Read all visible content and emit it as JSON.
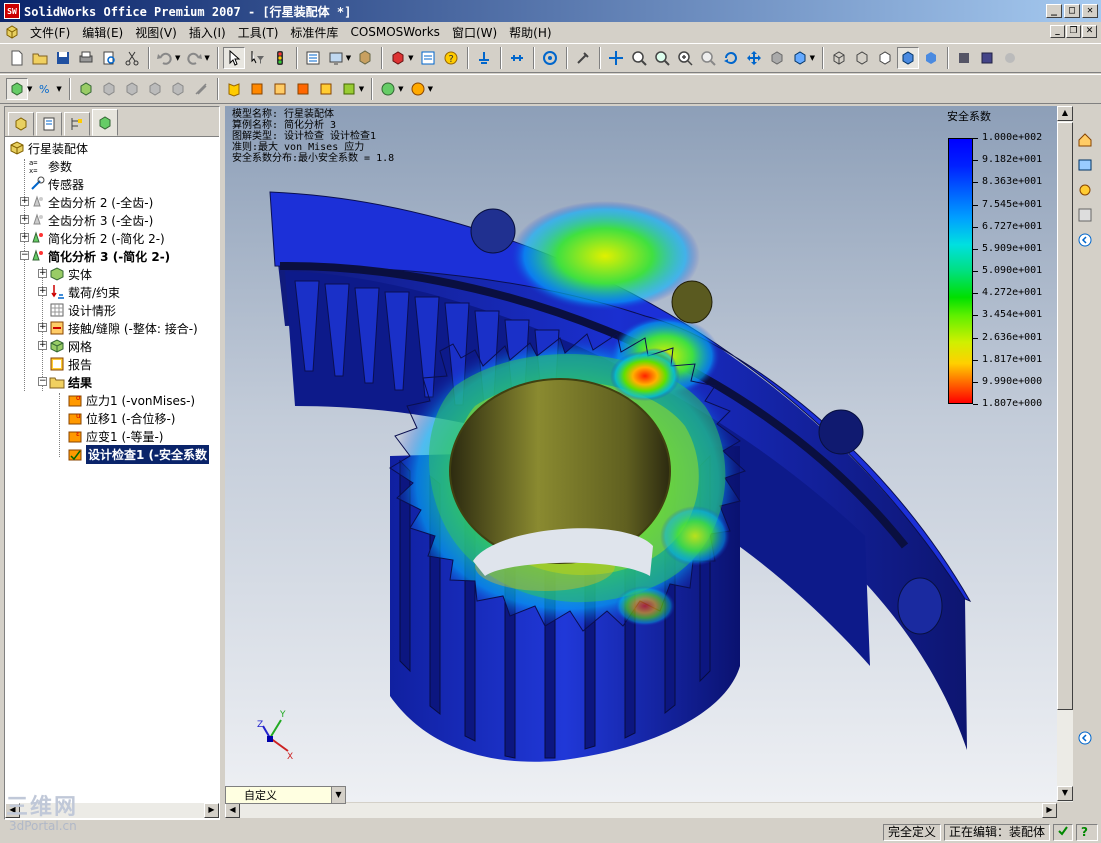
{
  "window": {
    "title": "SolidWorks Office Premium 2007 - [行星装配体 *]",
    "app_icon_text": "SW"
  },
  "menu": {
    "items": [
      "文件(F)",
      "编辑(E)",
      "视图(V)",
      "插入(I)",
      "工具(T)",
      "标准件库",
      "COSMOSWorks",
      "窗口(W)",
      "帮助(H)"
    ]
  },
  "toolbar1": {
    "icons": [
      "new-icon",
      "open-icon",
      "save-icon",
      "print-icon",
      "print-preview-icon",
      "cut-icon",
      "copy-icon",
      "paste-icon",
      "undo-icon",
      "redo-icon",
      "select-icon",
      "select-filter-icon",
      "rebuild-icon",
      "options-icon",
      "display-icon",
      "component-icon",
      "help-icon",
      "mate-icon",
      "bom-icon",
      "zoom-fit-icon",
      "zoom-area-icon",
      "zoom-in-icon",
      "pan-icon",
      "rotate-icon",
      "view-orientation-icon",
      "wireframe-icon",
      "hidden-lines-icon",
      "shaded-icon",
      "shaded-edges-icon"
    ]
  },
  "tree": {
    "root": "行星装配体",
    "items": [
      {
        "label": "参数",
        "icon": "parameters-icon",
        "level": 1
      },
      {
        "label": "传感器",
        "icon": "sensor-icon",
        "level": 1
      },
      {
        "label": "全齿分析 2 (-全齿-)",
        "icon": "study-icon",
        "level": 1
      },
      {
        "label": "全齿分析 3 (-全齿-)",
        "icon": "study-icon",
        "level": 1
      },
      {
        "label": "简化分析  2 (-简化  2-)",
        "icon": "study-icon",
        "level": 1
      },
      {
        "label": "简化分析  3 (-简化  2-)",
        "icon": "study-icon",
        "level": 1,
        "bold": true
      },
      {
        "label": "实体",
        "icon": "solid-icon",
        "level": 2
      },
      {
        "label": "载荷/约束",
        "icon": "load-icon",
        "level": 2
      },
      {
        "label": "设计情形",
        "icon": "design-scenario-icon",
        "level": 2
      },
      {
        "label": "接触/缝隙 (-整体: 接合-)",
        "icon": "contact-icon",
        "level": 2
      },
      {
        "label": "网格",
        "icon": "mesh-icon",
        "level": 2
      },
      {
        "label": "报告",
        "icon": "report-icon",
        "level": 2
      },
      {
        "label": "结果",
        "icon": "results-folder-icon",
        "level": 2,
        "bold": true
      },
      {
        "label": "应力1 (-vonMises-)",
        "icon": "stress-plot-icon",
        "level": 3
      },
      {
        "label": "位移1 (-合位移-)",
        "icon": "displacement-plot-icon",
        "level": 3
      },
      {
        "label": "应变1 (-等量-)",
        "icon": "strain-plot-icon",
        "level": 3
      },
      {
        "label": "设计检查1 (-安全系数",
        "icon": "design-check-icon",
        "level": 3,
        "bold": true,
        "selected": true
      }
    ]
  },
  "viewport": {
    "info_lines": [
      "模型名称: 行星装配体",
      "算例名称: 简化分析 3",
      "图解类型: 设计检查 设计检查1",
      "准则:最大 von Mises 应力",
      "安全系数分布:最小安全系数 = 1.8"
    ],
    "legend_title": "安全系数",
    "legend_values": [
      "1.000e+002",
      "9.182e+001",
      "8.363e+001",
      "7.545e+001",
      "6.727e+001",
      "5.909e+001",
      "5.090e+001",
      "4.272e+001",
      "3.454e+001",
      "2.636e+001",
      "1.817e+001",
      "9.990e+000",
      "1.807e+000"
    ],
    "view_select": "自定义",
    "triad_labels": [
      "Y",
      "Z",
      "X"
    ]
  },
  "statusbar": {
    "fully_defined": "完全定义",
    "editing": "正在编辑：装配体"
  },
  "watermark": {
    "text": "三维网",
    "url": "3dPortal.cn"
  },
  "colors": {
    "title_start": "#0a246a",
    "title_end": "#a6caf0",
    "selection": "#0a246a",
    "model_blue": "#1a2fd0"
  }
}
